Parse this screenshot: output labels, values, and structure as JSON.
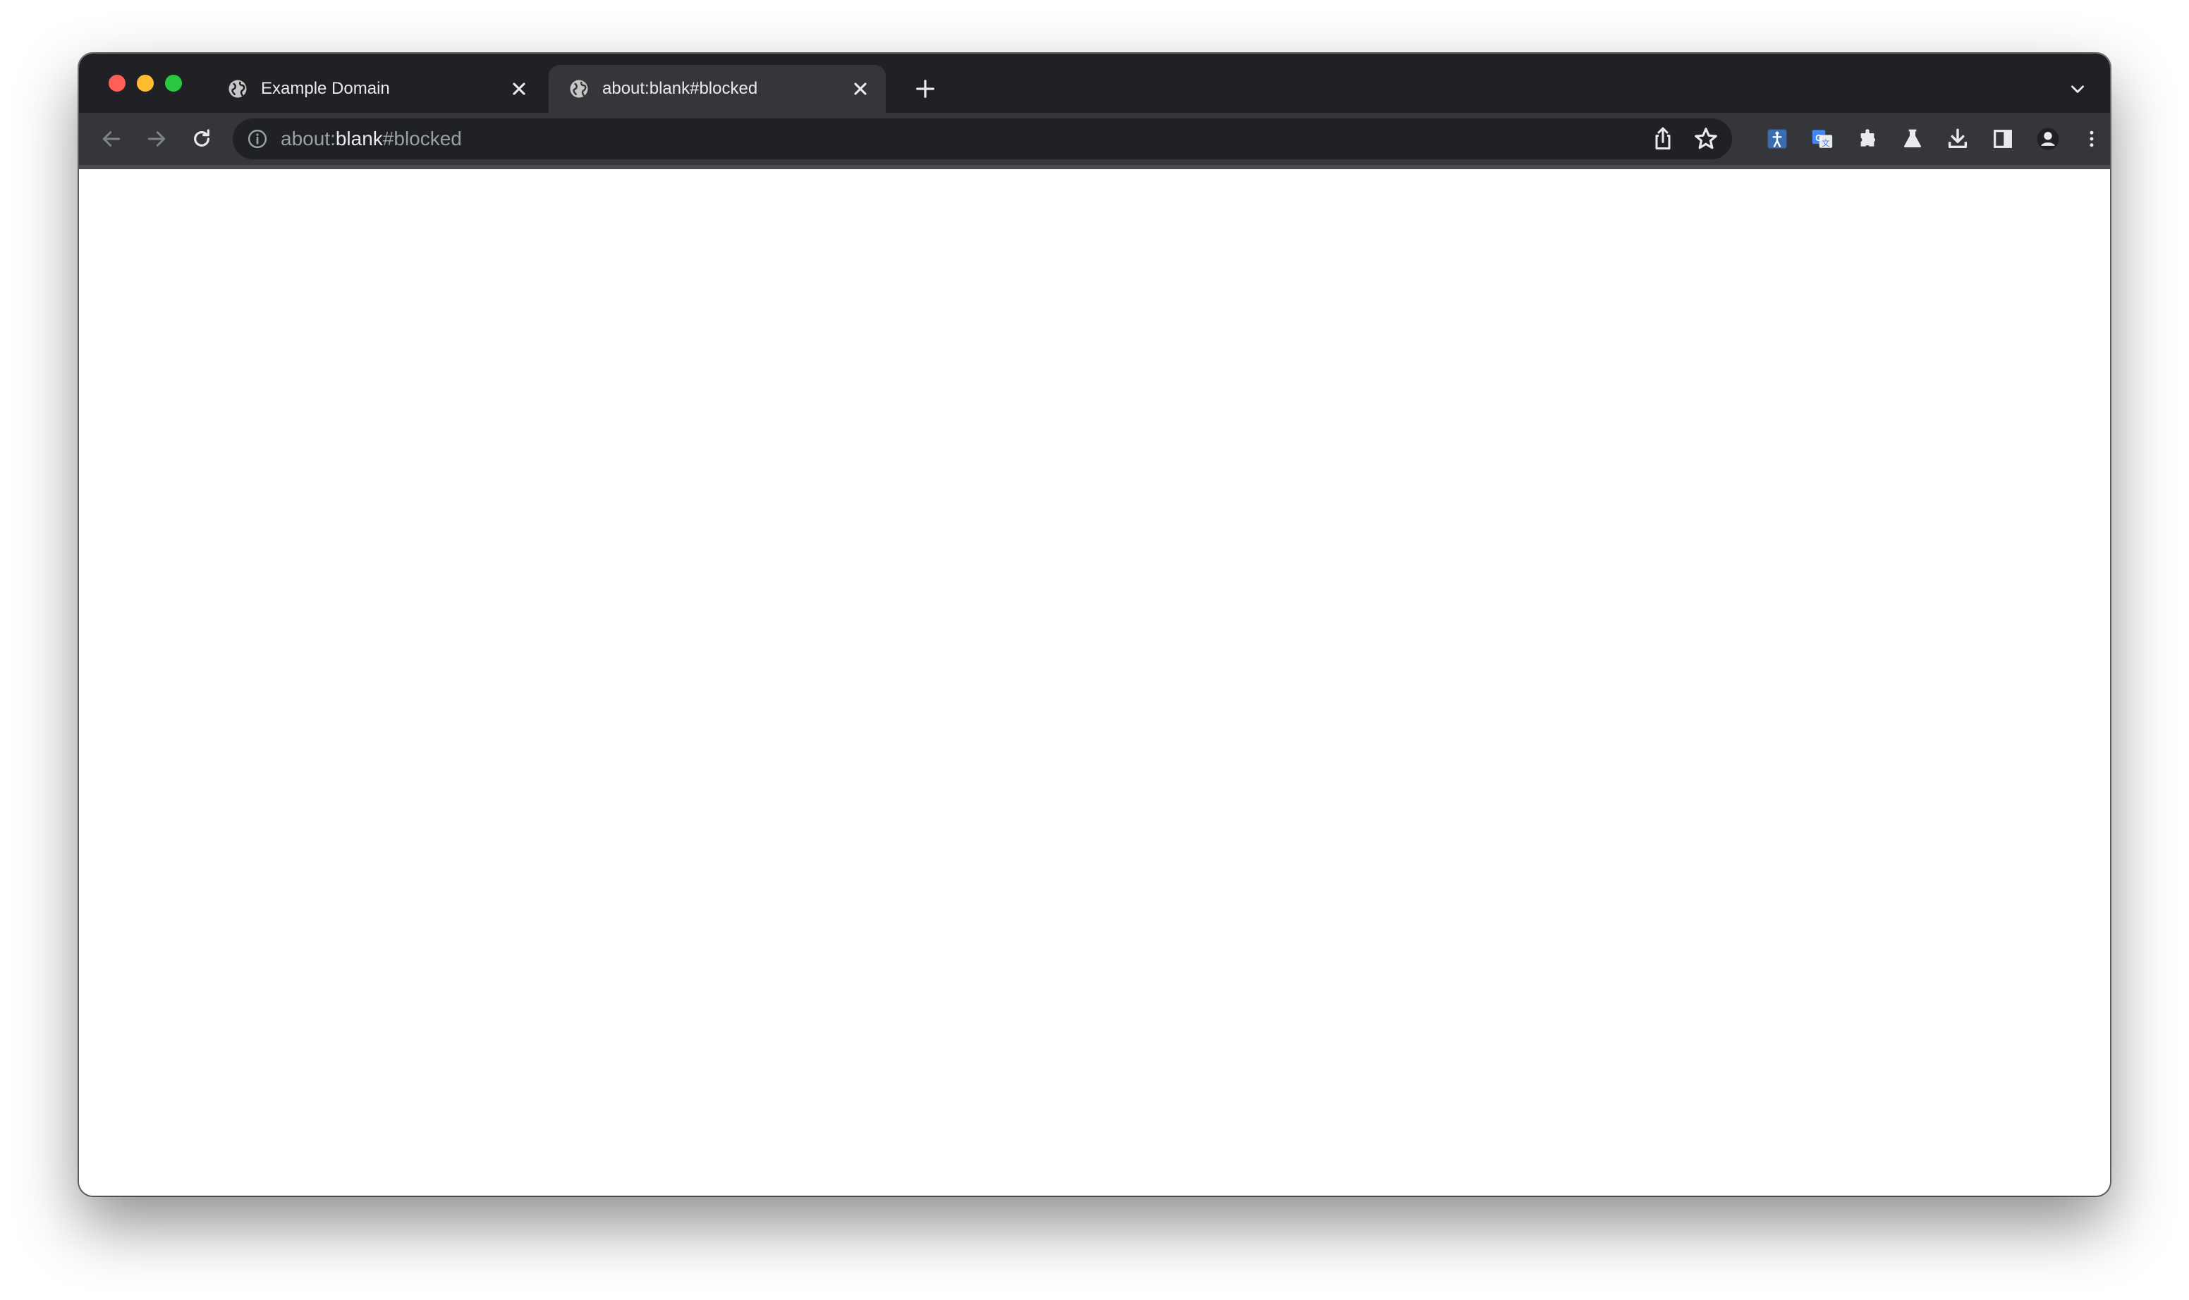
{
  "browser": {
    "tabs": [
      {
        "title": "Example Domain",
        "active": false
      },
      {
        "title": "about:blank#blocked",
        "active": true
      }
    ],
    "address_bar": {
      "scheme": "about:",
      "host": "blank",
      "fragment": "#blocked"
    },
    "colors": {
      "tabstrip": "#202124",
      "toolbar": "#35363a",
      "omnibox": "#202124",
      "text": "#e8eaed",
      "muted": "#9aa0a6"
    },
    "icons": [
      "globe-icon",
      "close-icon",
      "plus-icon",
      "chevron-down-icon",
      "back-arrow-icon",
      "forward-arrow-icon",
      "reload-icon",
      "info-icon",
      "share-icon",
      "star-icon",
      "accessibility-extension-icon",
      "google-translate-icon",
      "puzzle-icon",
      "flask-icon",
      "download-icon",
      "side-panel-icon",
      "profile-icon",
      "kebab-menu-icon"
    ]
  }
}
